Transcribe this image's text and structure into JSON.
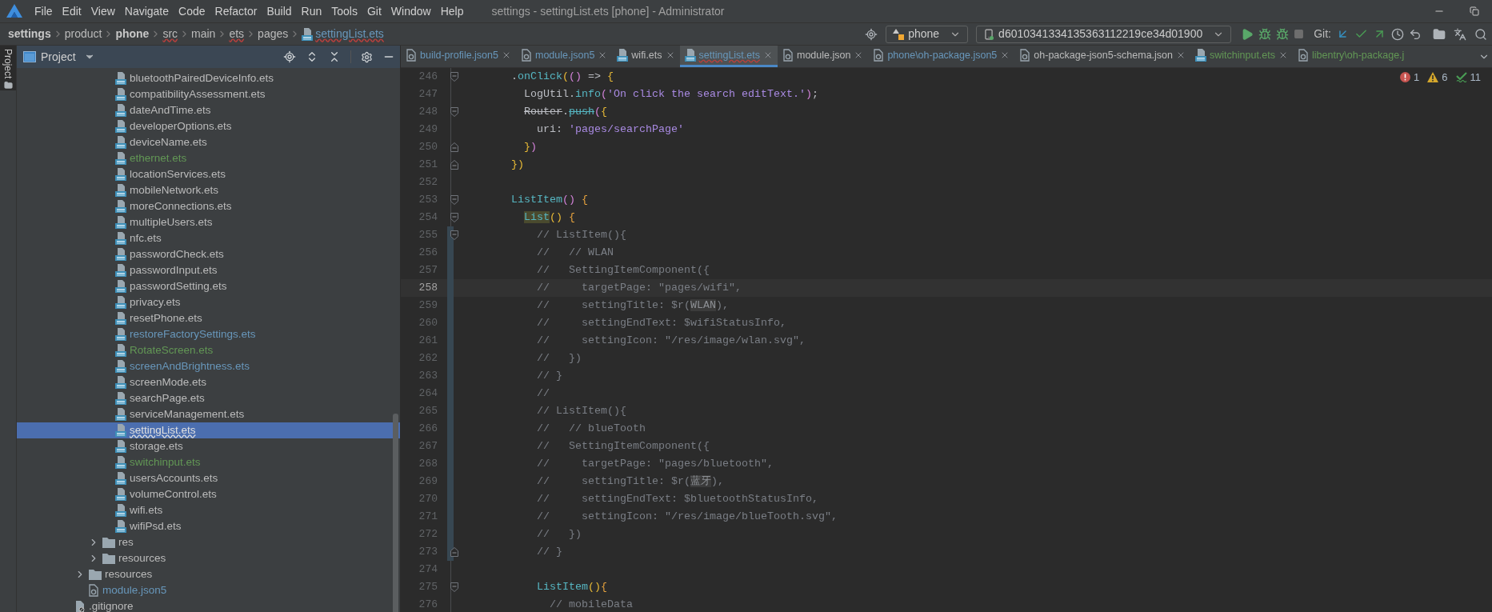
{
  "menu_bar": {
    "items": [
      "File",
      "Edit",
      "View",
      "Navigate",
      "Code",
      "Refactor",
      "Build",
      "Run",
      "Tools",
      "Git",
      "Window",
      "Help"
    ],
    "title": "settings - settingList.ets [phone] - Administrator"
  },
  "breadcrumb": [
    {
      "label": "settings",
      "kind": "module",
      "typo": false
    },
    {
      "label": "product",
      "kind": "dir",
      "typo": false
    },
    {
      "label": "phone",
      "kind": "module",
      "typo": false
    },
    {
      "label": "src",
      "kind": "dir",
      "typo": true
    },
    {
      "label": "main",
      "kind": "dir",
      "typo": false
    },
    {
      "label": "ets",
      "kind": "dir",
      "typo": true
    },
    {
      "label": "pages",
      "kind": "dir",
      "typo": false
    },
    {
      "label": "settingList.ets",
      "kind": "file",
      "typo": true
    }
  ],
  "toolbar": {
    "configuration": "phone",
    "device": "d6010341334135363112219ce34d01900",
    "git_label": "Git:"
  },
  "left_stripe": {
    "label": "Project",
    "selected": true
  },
  "project_panel": {
    "title": "Project",
    "tree": [
      {
        "children": [
          {
            "children": [
              {
                "children": [
                  {
                    "label": "bluetoothPairedDeviceInfo.ets",
                    "kind": "ets",
                    "color": "#bbbbbb",
                    "selected": false
                  },
                  {
                    "label": "compatibilityAssessment.ets",
                    "kind": "ets",
                    "color": "#bbbbbb",
                    "selected": false
                  },
                  {
                    "label": "dateAndTime.ets",
                    "kind": "ets",
                    "color": "#bbbbbb",
                    "selected": false
                  },
                  {
                    "label": "developerOptions.ets",
                    "kind": "ets",
                    "color": "#bbbbbb",
                    "selected": false
                  },
                  {
                    "label": "deviceName.ets",
                    "kind": "ets",
                    "color": "#bbbbbb",
                    "selected": false
                  },
                  {
                    "label": "ethernet.ets",
                    "kind": "ets",
                    "color": "#629755",
                    "selected": false
                  },
                  {
                    "label": "locationServices.ets",
                    "kind": "ets",
                    "color": "#bbbbbb",
                    "selected": false
                  },
                  {
                    "label": "mobileNetwork.ets",
                    "kind": "ets",
                    "color": "#bbbbbb",
                    "selected": false
                  },
                  {
                    "label": "moreConnections.ets",
                    "kind": "ets",
                    "color": "#bbbbbb",
                    "selected": false
                  },
                  {
                    "label": "multipleUsers.ets",
                    "kind": "ets",
                    "color": "#bbbbbb",
                    "selected": false
                  },
                  {
                    "label": "nfc.ets",
                    "kind": "ets",
                    "color": "#bbbbbb",
                    "selected": false
                  },
                  {
                    "label": "passwordCheck.ets",
                    "kind": "ets",
                    "color": "#bbbbbb",
                    "selected": false
                  },
                  {
                    "label": "passwordInput.ets",
                    "kind": "ets",
                    "color": "#bbbbbb",
                    "selected": false
                  },
                  {
                    "label": "passwordSetting.ets",
                    "kind": "ets",
                    "color": "#bbbbbb",
                    "selected": false
                  },
                  {
                    "label": "privacy.ets",
                    "kind": "ets",
                    "color": "#bbbbbb",
                    "selected": false
                  },
                  {
                    "label": "resetPhone.ets",
                    "kind": "ets",
                    "color": "#bbbbbb",
                    "selected": false
                  },
                  {
                    "label": "restoreFactorySettings.ets",
                    "kind": "ets",
                    "color": "#6897bb",
                    "selected": false
                  },
                  {
                    "label": "RotateScreen.ets",
                    "kind": "ets",
                    "color": "#629755",
                    "selected": false
                  },
                  {
                    "label": "screenAndBrightness.ets",
                    "kind": "ets",
                    "color": "#6897bb",
                    "selected": false
                  },
                  {
                    "label": "screenMode.ets",
                    "kind": "ets",
                    "color": "#bbbbbb",
                    "selected": false
                  },
                  {
                    "label": "searchPage.ets",
                    "kind": "ets",
                    "color": "#bbbbbb",
                    "selected": false
                  },
                  {
                    "label": "serviceManagement.ets",
                    "kind": "ets",
                    "color": "#bbbbbb",
                    "selected": false
                  },
                  {
                    "label": "settingList.ets",
                    "kind": "ets",
                    "selected": true
                  },
                  {
                    "label": "storage.ets",
                    "kind": "ets",
                    "color": "#bbbbbb",
                    "selected": false
                  },
                  {
                    "label": "switchinput.ets",
                    "kind": "ets",
                    "color": "#629755",
                    "selected": false
                  },
                  {
                    "label": "usersAccounts.ets",
                    "kind": "ets",
                    "color": "#bbbbbb",
                    "selected": false
                  },
                  {
                    "label": "volumeControl.ets",
                    "kind": "ets",
                    "color": "#bbbbbb",
                    "selected": false
                  },
                  {
                    "label": "wifi.ets",
                    "kind": "ets",
                    "color": "#bbbbbb",
                    "selected": false
                  },
                  {
                    "label": "wifiPsd.ets",
                    "kind": "ets",
                    "color": "#bbbbbb",
                    "selected": false
                  }
                ]
              },
              {
                "label": "res",
                "kind": "folder",
                "color": "#bbbbbb",
                "expanded": false,
                "selected": false
              },
              {
                "label": "resources",
                "kind": "folder",
                "color": "#bbbbbb",
                "expanded": false,
                "selected": false
              }
            ]
          },
          {
            "label": "resources",
            "kind": "folder",
            "color": "#bbbbbb",
            "expanded": false,
            "selected": false
          },
          {
            "label": "module.json5",
            "kind": "json",
            "color": "#6897bb",
            "selected": false
          }
        ]
      },
      {
        "label": ".gitignore",
        "kind": "ignored",
        "color": "#bbbbbb",
        "selected": false
      }
    ]
  },
  "tabs": [
    {
      "label": "build-profile.json5",
      "kind": "json",
      "color": "#6897bb",
      "selected": false,
      "typo": false,
      "closable": true
    },
    {
      "label": "module.json5",
      "kind": "json",
      "color": "#6897bb",
      "selected": false,
      "typo": false,
      "closable": true
    },
    {
      "label": "wifi.ets",
      "kind": "ets",
      "color": "#bbbbbb",
      "selected": false,
      "typo": false,
      "closable": true
    },
    {
      "label": "settingList.ets",
      "kind": "ets",
      "color": "#6897bb",
      "selected": true,
      "typo": true,
      "closable": true
    },
    {
      "label": "module.json",
      "kind": "json",
      "color": "#bbbbbb",
      "selected": false,
      "typo": false,
      "closable": true
    },
    {
      "label": "phone\\oh-package.json5",
      "kind": "json",
      "color": "#6897bb",
      "selected": false,
      "typo": false,
      "closable": true
    },
    {
      "label": "oh-package-json5-schema.json",
      "kind": "json",
      "color": "#bbbbbb",
      "selected": false,
      "typo": false,
      "closable": true
    },
    {
      "label": "switchinput.ets",
      "kind": "ets",
      "color": "#629755",
      "selected": false,
      "typo": false,
      "closable": true
    },
    {
      "label": "libentry\\oh-package.j",
      "kind": "json",
      "color": "#629755",
      "selected": false,
      "typo": false,
      "closable": false
    }
  ],
  "editor": {
    "problems": {
      "errors": "1",
      "warnings": "6",
      "typos": "11"
    },
    "lines": [
      {
        "number": "246",
        "current": false,
        "changed": false,
        "fold_start": true,
        "fold_end": false,
        "tokens": [
          {
            "text": "        .",
            "kind": "plain"
          },
          {
            "text": "onClick",
            "kind": "fn"
          },
          {
            "text": "(",
            "kind": "paren1"
          },
          {
            "text": "()",
            "kind": "paren2"
          },
          {
            "text": " => ",
            "kind": "plain"
          },
          {
            "text": "{",
            "kind": "paren1"
          }
        ]
      },
      {
        "number": "247",
        "current": false,
        "changed": false,
        "fold_start": false,
        "fold_end": false,
        "tokens": [
          {
            "text": "          LogUtil.",
            "kind": "plain"
          },
          {
            "text": "info",
            "kind": "fn"
          },
          {
            "text": "(",
            "kind": "paren2"
          },
          {
            "text": "'On click the search editText.'",
            "kind": "str"
          },
          {
            "text": ")",
            "kind": "paren2"
          },
          {
            "text": ";",
            "kind": "plain"
          }
        ]
      },
      {
        "number": "248",
        "current": false,
        "changed": false,
        "fold_start": true,
        "fold_end": false,
        "tokens": [
          {
            "text": "          Router",
            "kind": "deprecated"
          },
          {
            "text": ".",
            "kind": "plain"
          },
          {
            "text": "push",
            "kind": "deprecated_fn"
          },
          {
            "text": "(",
            "kind": "paren2"
          },
          {
            "text": "{",
            "kind": "paren1"
          }
        ]
      },
      {
        "number": "249",
        "current": false,
        "changed": false,
        "fold_start": false,
        "fold_end": false,
        "tokens": [
          {
            "text": "            uri: ",
            "kind": "plain"
          },
          {
            "text": "'pages/searchPage'",
            "kind": "str"
          }
        ]
      },
      {
        "number": "250",
        "current": false,
        "changed": false,
        "fold_start": false,
        "fold_end": true,
        "tokens": [
          {
            "text": "          }",
            "kind": "paren1"
          },
          {
            "text": ")",
            "kind": "paren2"
          }
        ]
      },
      {
        "number": "251",
        "current": false,
        "changed": false,
        "fold_start": false,
        "fold_end": true,
        "tokens": [
          {
            "text": "        })",
            "kind": "paren1"
          }
        ]
      },
      {
        "number": "252",
        "current": false,
        "changed": false,
        "fold_start": false,
        "fold_end": false
      },
      {
        "number": "253",
        "current": false,
        "changed": false,
        "fold_start": true,
        "fold_end": false,
        "tokens": [
          {
            "text": "        ListItem",
            "kind": "fn"
          },
          {
            "text": "()",
            "kind": "paren2"
          },
          {
            "text": " {",
            "kind": "brace"
          }
        ]
      },
      {
        "number": "254",
        "current": false,
        "changed": false,
        "fold_start": true,
        "fold_end": false,
        "tokens": [
          {
            "text": "          List",
            "kind": "match"
          },
          {
            "text": "()",
            "kind": "paren1"
          },
          {
            "text": " {",
            "kind": "brace"
          }
        ]
      },
      {
        "number": "255",
        "current": false,
        "changed": true,
        "fold_start": true,
        "fold_end": false,
        "tokens": [
          {
            "text": "            // ListItem(){",
            "kind": "comment"
          }
        ]
      },
      {
        "number": "256",
        "current": false,
        "changed": true,
        "fold_start": false,
        "fold_end": false,
        "tokens": [
          {
            "text": "            //   // WLAN",
            "kind": "comment"
          }
        ]
      },
      {
        "number": "257",
        "current": false,
        "changed": true,
        "fold_start": false,
        "fold_end": false,
        "tokens": [
          {
            "text": "            //   SettingItemComponent({",
            "kind": "comment"
          }
        ]
      },
      {
        "number": "258",
        "current": true,
        "changed": true,
        "fold_start": false,
        "fold_end": false,
        "tokens": [
          {
            "text": "            //     targetPage: \"pages/wifi\",",
            "kind": "comment"
          }
        ]
      },
      {
        "number": "259",
        "current": false,
        "changed": true,
        "fold_start": false,
        "fold_end": false,
        "tokens": [
          {
            "text": "            //     settingTitle: $r(",
            "kind": "comment"
          },
          {
            "text": "WLAN",
            "kind": "comment_match"
          },
          {
            "text": "),",
            "kind": "comment"
          }
        ]
      },
      {
        "number": "260",
        "current": false,
        "changed": true,
        "fold_start": false,
        "fold_end": false,
        "tokens": [
          {
            "text": "            //     settingEndText: $wifiStatusInfo,",
            "kind": "comment"
          }
        ]
      },
      {
        "number": "261",
        "current": false,
        "changed": true,
        "fold_start": false,
        "fold_end": false,
        "tokens": [
          {
            "text": "            //     settingIcon: \"/res/image/wlan.svg\",",
            "kind": "comment"
          }
        ]
      },
      {
        "number": "262",
        "current": false,
        "changed": true,
        "fold_start": false,
        "fold_end": false,
        "tokens": [
          {
            "text": "            //   })",
            "kind": "comment"
          }
        ]
      },
      {
        "number": "263",
        "current": false,
        "changed": true,
        "fold_start": false,
        "fold_end": false,
        "tokens": [
          {
            "text": "            // }",
            "kind": "comment"
          }
        ]
      },
      {
        "number": "264",
        "current": false,
        "changed": true,
        "fold_start": false,
        "fold_end": false,
        "tokens": [
          {
            "text": "            //",
            "kind": "comment"
          }
        ]
      },
      {
        "number": "265",
        "current": false,
        "changed": true,
        "fold_start": false,
        "fold_end": false,
        "tokens": [
          {
            "text": "            // ListItem(){",
            "kind": "comment"
          }
        ]
      },
      {
        "number": "266",
        "current": false,
        "changed": true,
        "fold_start": false,
        "fold_end": false,
        "tokens": [
          {
            "text": "            //   // blueTooth",
            "kind": "comment"
          }
        ]
      },
      {
        "number": "267",
        "current": false,
        "changed": true,
        "fold_start": false,
        "fold_end": false,
        "tokens": [
          {
            "text": "            //   SettingItemComponent({",
            "kind": "comment"
          }
        ]
      },
      {
        "number": "268",
        "current": false,
        "changed": true,
        "fold_start": false,
        "fold_end": false,
        "tokens": [
          {
            "text": "            //     targetPage: \"pages/bluetooth\",",
            "kind": "comment"
          }
        ]
      },
      {
        "number": "269",
        "current": false,
        "changed": true,
        "fold_start": false,
        "fold_end": false,
        "tokens": [
          {
            "text": "            //     settingTitle: $r(",
            "kind": "comment"
          },
          {
            "text": "蓝牙",
            "kind": "comment_match"
          },
          {
            "text": "),",
            "kind": "comment"
          }
        ]
      },
      {
        "number": "270",
        "current": false,
        "changed": true,
        "fold_start": false,
        "fold_end": false,
        "tokens": [
          {
            "text": "            //     settingEndText: $bluetoothStatusInfo,",
            "kind": "comment"
          }
        ]
      },
      {
        "number": "271",
        "current": false,
        "changed": true,
        "fold_start": false,
        "fold_end": false,
        "tokens": [
          {
            "text": "            //     settingIcon: \"/res/image/blueTooth.svg\",",
            "kind": "comment"
          }
        ]
      },
      {
        "number": "272",
        "current": false,
        "changed": true,
        "fold_start": false,
        "fold_end": false,
        "tokens": [
          {
            "text": "            //   })",
            "kind": "comment"
          }
        ]
      },
      {
        "number": "273",
        "current": false,
        "changed": true,
        "fold_start": false,
        "fold_end": true,
        "tokens": [
          {
            "text": "            // }",
            "kind": "comment"
          }
        ]
      },
      {
        "number": "274",
        "current": false,
        "changed": false,
        "fold_start": false,
        "fold_end": false
      },
      {
        "number": "275",
        "current": false,
        "changed": false,
        "fold_start": true,
        "fold_end": false,
        "tokens": [
          {
            "text": "            ListItem",
            "kind": "fn"
          },
          {
            "text": "()",
            "kind": "paren1"
          },
          {
            "text": "{",
            "kind": "brace"
          }
        ]
      },
      {
        "number": "276",
        "current": false,
        "changed": false,
        "fold_start": false,
        "fold_end": false,
        "tokens": [
          {
            "text": "              // mobileData",
            "kind": "comment"
          }
        ]
      }
    ]
  }
}
